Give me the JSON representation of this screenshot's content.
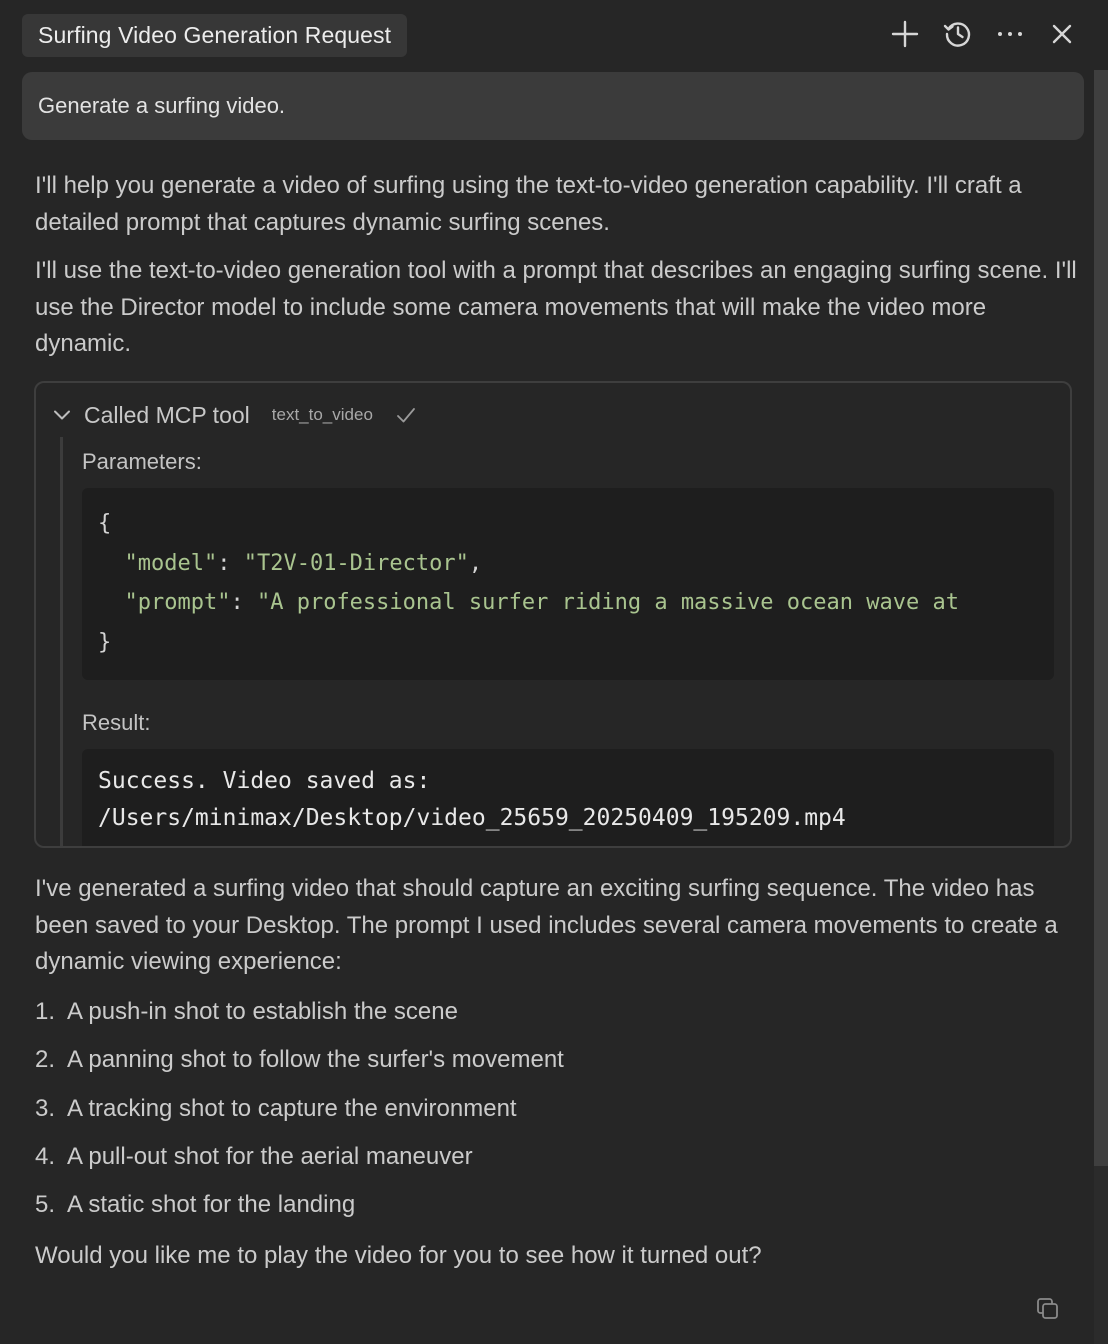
{
  "header": {
    "title": "Surfing Video Generation Request",
    "icons": [
      "plus-icon",
      "history-icon",
      "more-icon",
      "close-icon"
    ]
  },
  "user_message": "Generate a surfing video.",
  "assistant": {
    "para1": "I'll help you generate a video of surfing using the text-to-video generation capability. I'll craft a detailed prompt that captures dynamic surfing scenes.",
    "para2": "I'll use the text-to-video generation tool with a prompt that describes an engaging surfing scene. I'll use the Director model to include some camera movements that will make the video more dynamic.",
    "tool": {
      "header_label": "Called MCP tool",
      "tool_name": "text_to_video",
      "parameters_label": "Parameters:",
      "param_open": "{",
      "param_close": "}",
      "param_model_key": "\"model\"",
      "param_model_value": "\"T2V-01-Director\"",
      "param_prompt_key": "\"prompt\"",
      "param_prompt_value": "\"A professional surfer riding a massive ocean wave at",
      "result_label": "Result:",
      "result_line1": "Success. Video saved as:",
      "result_line2": "/Users/minimax/Desktop/video_25659_20250409_195209.mp4"
    },
    "para3": "I've generated a surfing video that should capture an exciting surfing sequence. The video has been saved to your Desktop. The prompt I used includes several camera movements to create a dynamic viewing experience:",
    "list": [
      {
        "num": "1.",
        "text": "A push-in shot to establish the scene"
      },
      {
        "num": "2.",
        "text": "A panning shot to follow the surfer's movement"
      },
      {
        "num": "3.",
        "text": "A tracking shot to capture the environment"
      },
      {
        "num": "4.",
        "text": "A pull-out shot for the aerial maneuver"
      },
      {
        "num": "5.",
        "text": "A static shot for the landing"
      }
    ],
    "para4": "Would you like me to play the video for you to see how it turned out?"
  },
  "colors": {
    "background": "#262626",
    "user_bubble": "#3b3b3b",
    "code_bg": "#1e1e1e",
    "string_green": "#a9c48f"
  }
}
